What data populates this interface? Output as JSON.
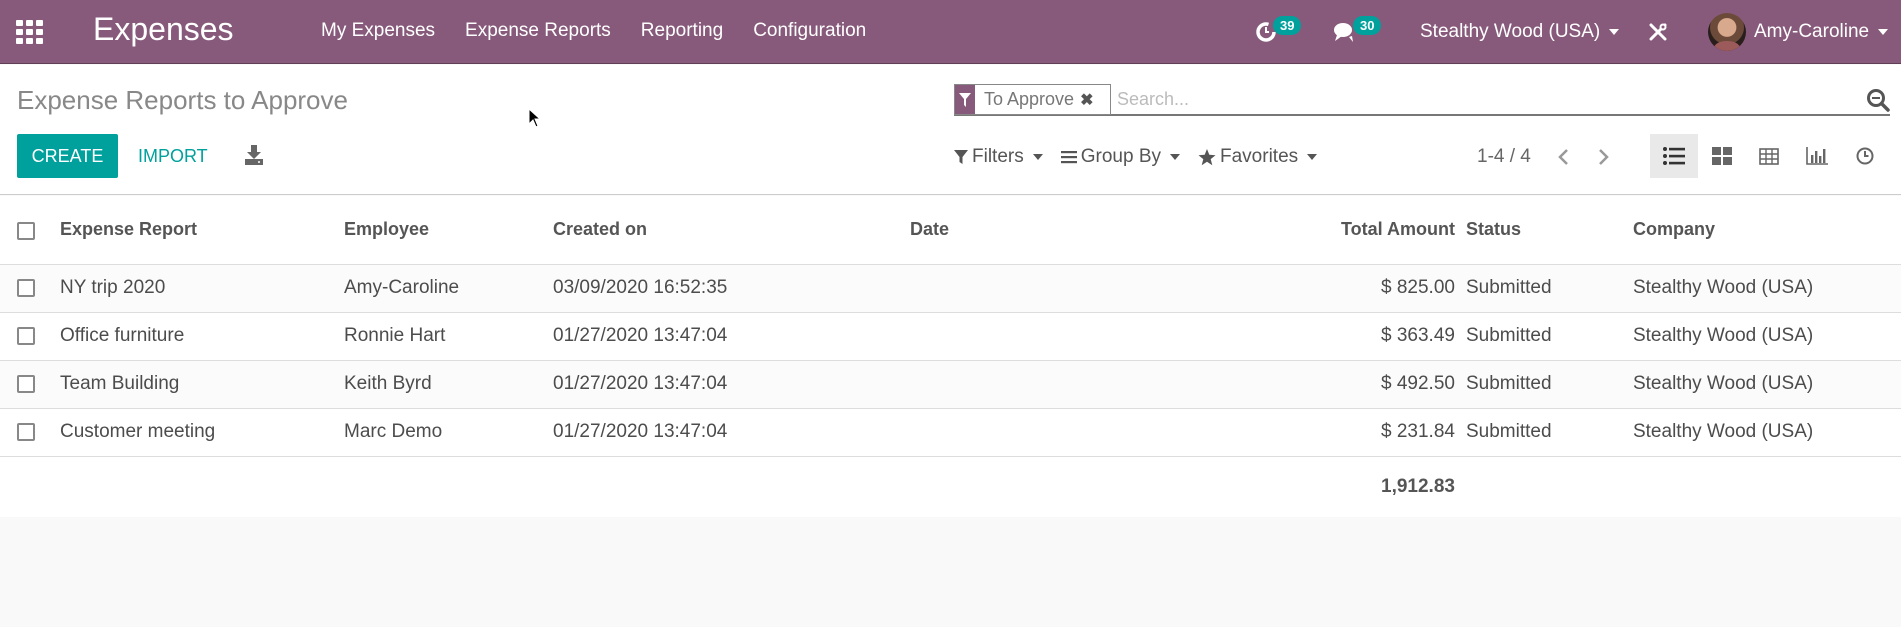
{
  "navbar": {
    "app_name": "Expenses",
    "menu": [
      "My Expenses",
      "Expense Reports",
      "Reporting",
      "Configuration"
    ],
    "activity_count": "39",
    "message_count": "30",
    "company": "Stealthy Wood (USA)",
    "user": "Amy-Caroline"
  },
  "control_panel": {
    "title": "Expense Reports to Approve",
    "create_label": "CREATE",
    "import_label": "IMPORT",
    "search": {
      "facet_label": "To Approve",
      "placeholder": "Search...",
      "value": ""
    },
    "filters_label": "Filters",
    "groupby_label": "Group By",
    "favorites_label": "Favorites",
    "pager": "1-4 / 4",
    "views": [
      "list",
      "kanban",
      "pivot",
      "graph",
      "activity"
    ],
    "active_view": "list"
  },
  "table": {
    "columns": [
      "Expense Report",
      "Employee",
      "Created on",
      "Date",
      "Total Amount",
      "Status",
      "Company"
    ],
    "rows": [
      {
        "name": "NY trip 2020",
        "employee": "Amy-Caroline",
        "created_on": "03/09/2020 16:52:35",
        "date": "",
        "total": "$ 825.00",
        "status": "Submitted",
        "company": "Stealthy Wood (USA)"
      },
      {
        "name": "Office furniture",
        "employee": "Ronnie Hart",
        "created_on": "01/27/2020 13:47:04",
        "date": "",
        "total": "$ 363.49",
        "status": "Submitted",
        "company": "Stealthy Wood (USA)"
      },
      {
        "name": "Team Building",
        "employee": "Keith Byrd",
        "created_on": "01/27/2020 13:47:04",
        "date": "",
        "total": "$ 492.50",
        "status": "Submitted",
        "company": "Stealthy Wood (USA)"
      },
      {
        "name": "Customer meeting",
        "employee": "Marc Demo",
        "created_on": "01/27/2020 13:47:04",
        "date": "",
        "total": "$ 231.84",
        "status": "Submitted",
        "company": "Stealthy Wood (USA)"
      }
    ],
    "footer_total": "1,912.83"
  },
  "colors": {
    "brand": "#875a7b",
    "accent": "#00a09d"
  }
}
